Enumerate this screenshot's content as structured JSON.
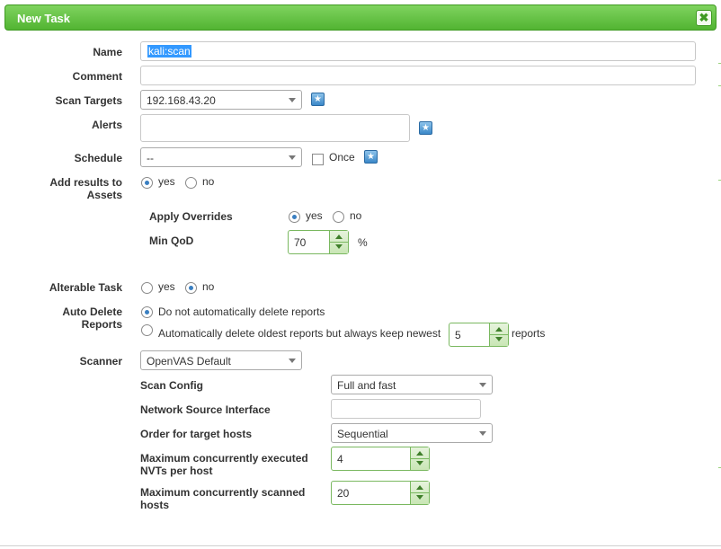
{
  "dialog": {
    "title": "New Task",
    "close_symbol": "✖"
  },
  "form": {
    "name": {
      "label": "Name",
      "value": "kali:scan"
    },
    "comment": {
      "label": "Comment",
      "value": ""
    },
    "scan_targets": {
      "label": "Scan Targets",
      "selected": "192.168.43.20"
    },
    "alerts": {
      "label": "Alerts"
    },
    "schedule": {
      "label": "Schedule",
      "selected": "--",
      "once_label": "Once"
    },
    "add_results": {
      "label_line1": "Add results to",
      "label_line2": "Assets",
      "yes": "yes",
      "no": "no",
      "selected": "yes"
    },
    "apply_overrides": {
      "label": "Apply Overrides",
      "yes": "yes",
      "no": "no",
      "selected": "yes"
    },
    "min_qod": {
      "label": "Min QoD",
      "value": "70",
      "unit": "%"
    },
    "alterable_task": {
      "label": "Alterable Task",
      "yes": "yes",
      "no": "no",
      "selected": "no"
    },
    "auto_delete": {
      "label_line1": "Auto Delete",
      "label_line2": "Reports",
      "option_no_delete": "Do not automatically delete reports",
      "option_delete": "Automatically delete oldest reports but always keep newest",
      "keep_value": "5",
      "keep_unit": "reports",
      "selected": "no_delete"
    },
    "scanner": {
      "label": "Scanner",
      "selected": "OpenVAS Default"
    },
    "scan_config": {
      "label": "Scan Config",
      "selected": "Full and fast"
    },
    "network_source_interface": {
      "label": "Network Source Interface",
      "value": ""
    },
    "order_target_hosts": {
      "label": "Order for target hosts",
      "selected": "Sequential"
    },
    "max_nvts": {
      "label_line1": "Maximum concurrently executed",
      "label_line2": "NVTs per host",
      "value": "4"
    },
    "max_hosts": {
      "label_line1": "Maximum concurrently scanned",
      "label_line2": "hosts",
      "value": "20"
    }
  },
  "colors": {
    "titlebar": "#52b432",
    "accent_blue": "#3b88c8",
    "spinner_border": "#7ab860"
  },
  "icons": {
    "new_target": "star-icon",
    "new_alert": "star-icon",
    "new_schedule": "star-icon",
    "close": "close-icon"
  }
}
